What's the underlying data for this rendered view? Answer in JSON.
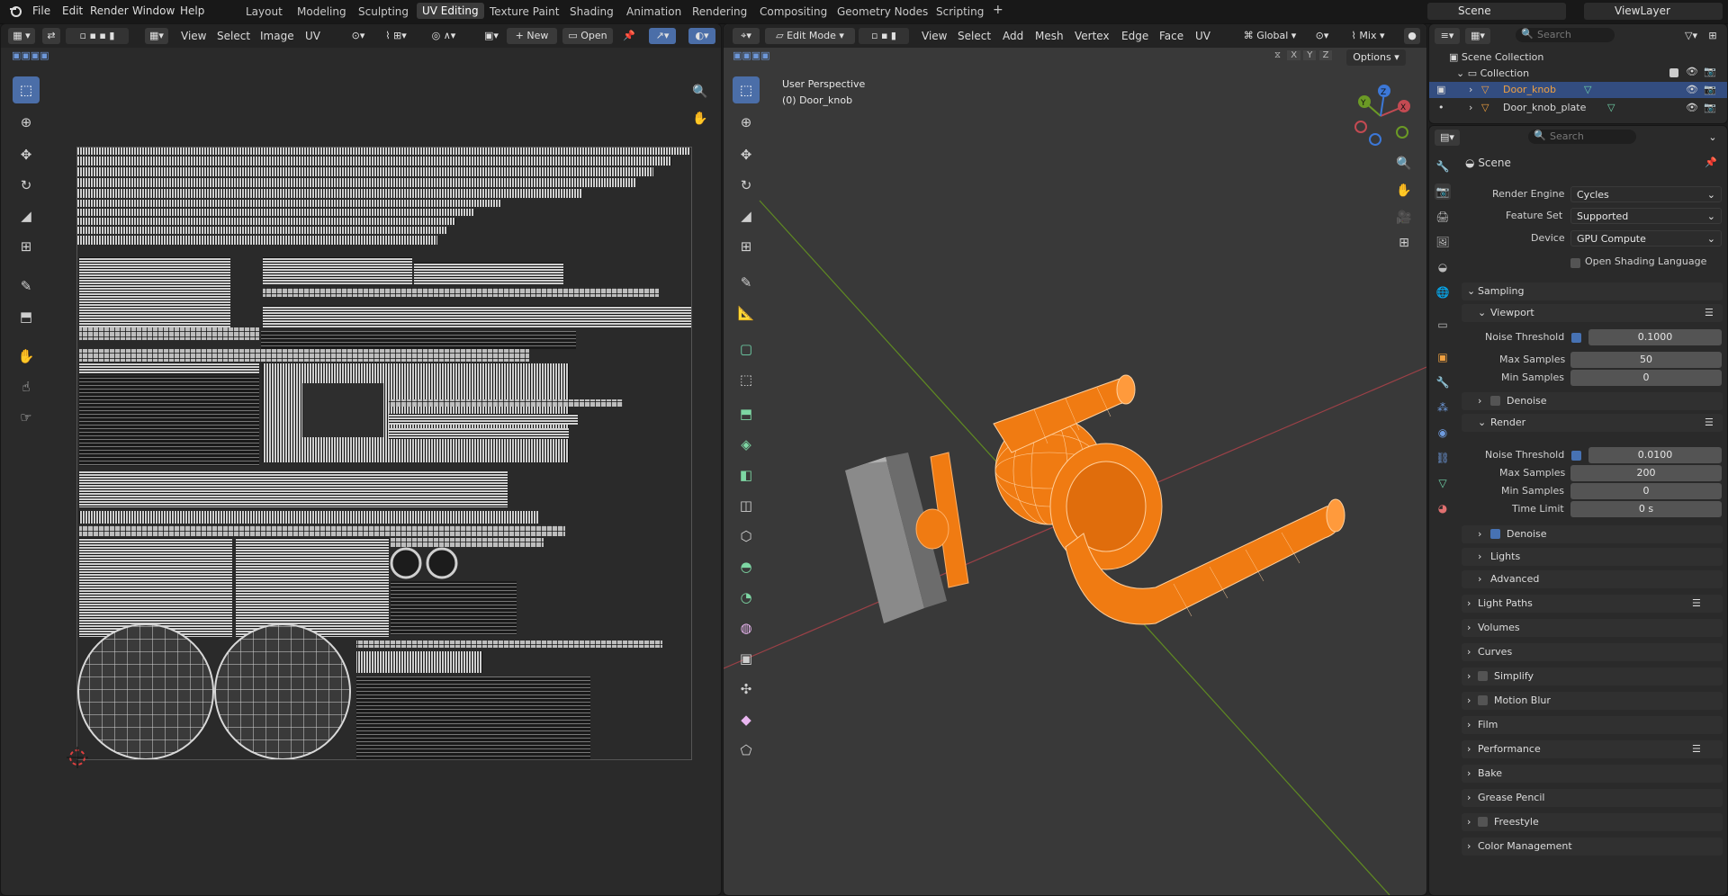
{
  "top_menu": [
    "File",
    "Edit",
    "Render",
    "Window",
    "Help"
  ],
  "workspaces": [
    "Layout",
    "Modeling",
    "Sculpting",
    "UV Editing",
    "Texture Paint",
    "Shading",
    "Animation",
    "Rendering",
    "Compositing",
    "Geometry Nodes",
    "Scripting"
  ],
  "active_workspace": "UV Editing",
  "scene_field": "Scene",
  "viewlayer_field": "ViewLayer",
  "uv_editor": {
    "menus": [
      "View",
      "Select",
      "Image",
      "UV"
    ],
    "new_label": "New",
    "open_label": "Open"
  },
  "viewport": {
    "mode": "Edit Mode",
    "menus": [
      "View",
      "Select",
      "Add",
      "Mesh",
      "Vertex",
      "Edge",
      "Face",
      "UV"
    ],
    "transform": "Global",
    "shading": "Mix",
    "axes": [
      "X",
      "Y",
      "Z"
    ],
    "options_label": "Options",
    "overlay_line1": "User Perspective",
    "overlay_line2": "(0) Door_knob",
    "gizmo_labels": [
      "X",
      "Y",
      "Z"
    ]
  },
  "outliner": {
    "search_placeholder": "Search",
    "items": [
      {
        "label": "Scene Collection"
      },
      {
        "label": "Collection"
      },
      {
        "label": "Door_knob"
      },
      {
        "label": "Door_knob_plate"
      }
    ]
  },
  "properties": {
    "search_placeholder": "Search",
    "context": "Scene",
    "render_engine_label": "Render Engine",
    "render_engine": "Cycles",
    "feature_set_label": "Feature Set",
    "feature_set": "Supported",
    "device_label": "Device",
    "device": "GPU Compute",
    "osl_label": "Open Shading Language",
    "sampling": "Sampling",
    "viewport": "Viewport",
    "noise_threshold_label": "Noise Threshold",
    "vp_noise": "0.1000",
    "max_samples_label": "Max Samples",
    "vp_max": "50",
    "min_samples_label": "Min Samples",
    "vp_min": "0",
    "denoise": "Denoise",
    "render": "Render",
    "r_noise": "0.0100",
    "r_max": "200",
    "r_min": "0",
    "time_limit_label": "Time Limit",
    "r_time": "0 s",
    "lights": "Lights",
    "advanced": "Advanced",
    "panels": [
      "Light Paths",
      "Volumes",
      "Curves",
      "Simplify",
      "Motion Blur",
      "Film",
      "Performance",
      "Bake",
      "Grease Pencil",
      "Freestyle",
      "Color Management"
    ]
  },
  "colors": {
    "selection": "#f07b12",
    "accent": "#4772b3",
    "x_axis": "#c34a52",
    "y_axis": "#6b9a25"
  }
}
